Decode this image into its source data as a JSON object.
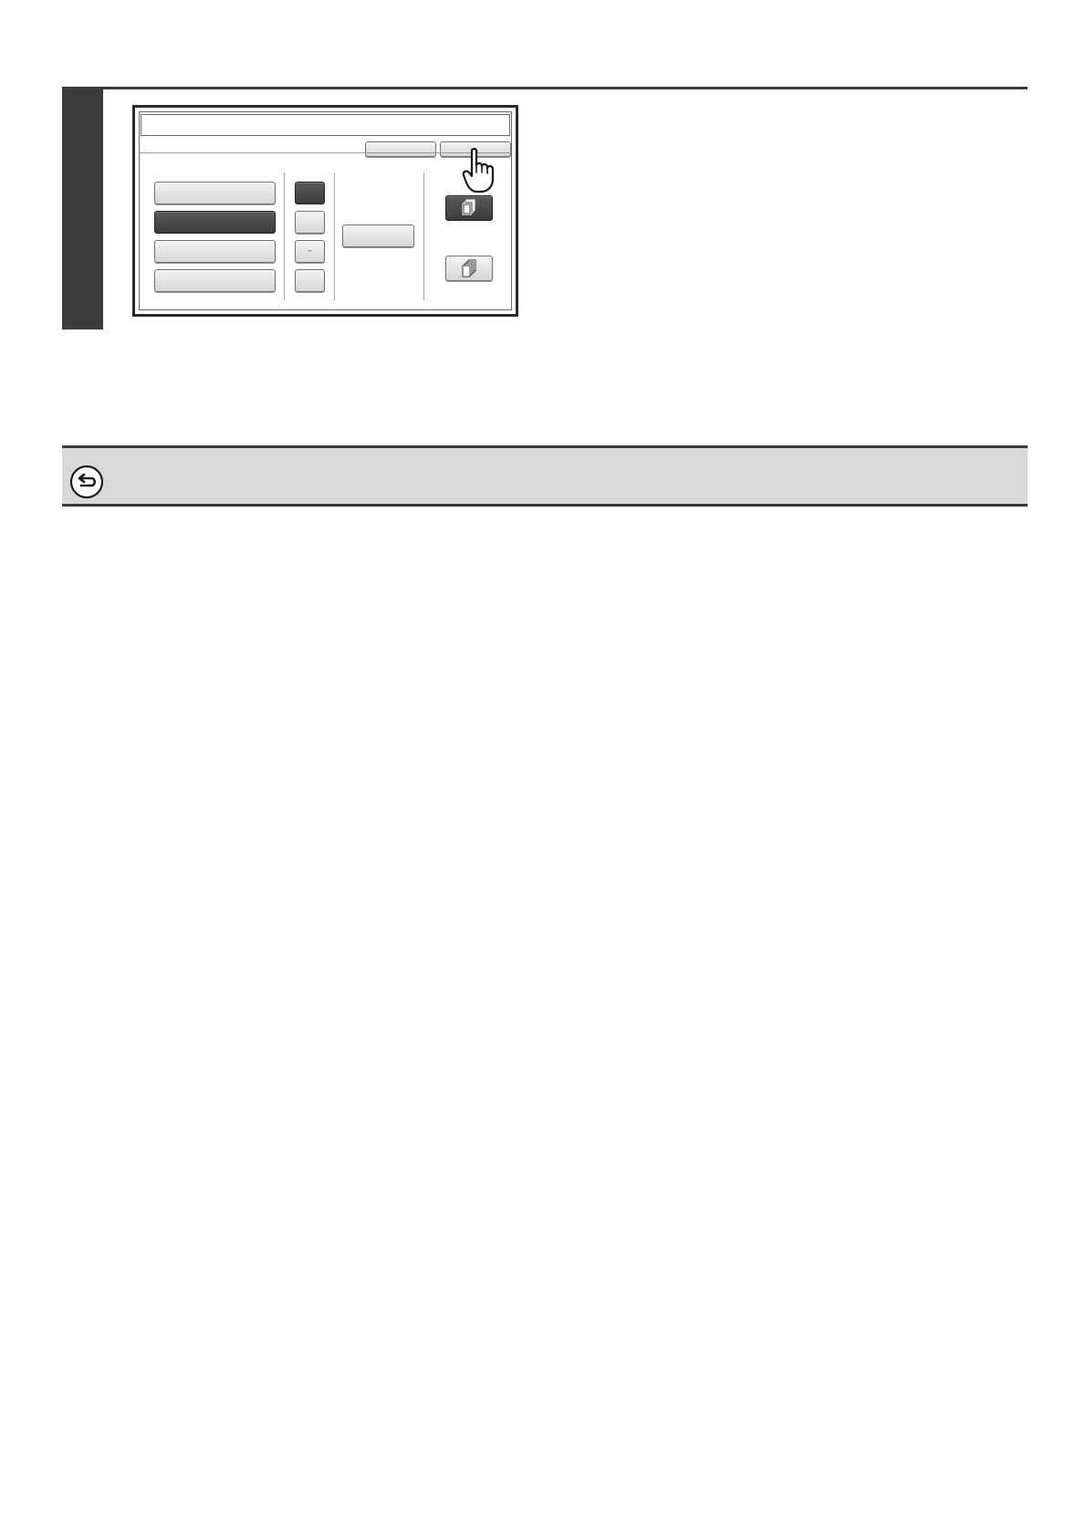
{
  "step_illustration": {
    "minus_symbol": "–",
    "icons": {
      "hand_pointer": "hand-pointer-icon",
      "collate_on": "sort-stack-icon",
      "collate_off": "group-stack-icon",
      "return": "return-arrow-icon"
    },
    "selected_list_item": 2,
    "selected_quantity_box": 1,
    "selected_output_mode": "top"
  },
  "colors": {
    "step_bar": "#3c3c3c",
    "note_background": "#d9d9d9",
    "selected_button": "#3a3a3a"
  }
}
